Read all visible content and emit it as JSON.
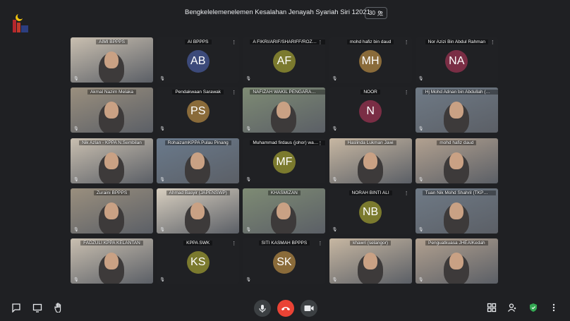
{
  "meeting": {
    "title": "Bengkelelemenelemen Kesalahan Jenayah Syariah Siri 12021",
    "participant_count": "30"
  },
  "colors": {
    "background": "#1f2023",
    "tile": "#3c4043",
    "hangup": "#ea4335",
    "shield": "#34a853"
  },
  "tiles": [
    {
      "name": "AIMI BPPPS",
      "initials": "",
      "avatar_color": "",
      "type": "video"
    },
    {
      "name": "AI BPPPS",
      "initials": "AB",
      "avatar_color": "#3c4a7a",
      "type": "avatar"
    },
    {
      "name": "A FIKRI/ARIF/SHARIFF/ROZAINA ...",
      "initials": "AF",
      "avatar_color": "#7b7a2e",
      "type": "avatar"
    },
    {
      "name": "mohd hafiz bin daud",
      "initials": "MH",
      "avatar_color": "#8a6b3a",
      "type": "avatar"
    },
    {
      "name": "Nor Azizi Bin Abdul Rahman",
      "initials": "NA",
      "avatar_color": "#7a2e45",
      "type": "avatar"
    },
    {
      "name": "Akmal Nazim Melaka",
      "initials": "",
      "avatar_color": "",
      "type": "video"
    },
    {
      "name": "Pendakwaan Sarawak",
      "initials": "PS",
      "avatar_color": "#8a6b3a",
      "type": "avatar"
    },
    {
      "name": "NAFIZAH WAKIL PENGARAH BPP...",
      "initials": "",
      "avatar_color": "",
      "type": "video"
    },
    {
      "name": "NOOR",
      "initials": "N",
      "avatar_color": "#7a2e45",
      "type": "avatar"
    },
    {
      "name": "Hj Mohd Adnan bin Abdullah (JHEA...",
      "initials": "",
      "avatar_color": "",
      "type": "video"
    },
    {
      "name": "Nik Azlan - KPPA N.Sembilan",
      "initials": "",
      "avatar_color": "",
      "type": "video"
    },
    {
      "name": "RohaizamKPPA Pulau Pinang",
      "initials": "",
      "avatar_color": "",
      "type": "video"
    },
    {
      "name": "Muhammad firdaus (johor) wakil kppa",
      "initials": "MF",
      "avatar_color": "#7b7a2e",
      "type": "avatar"
    },
    {
      "name": "Haslinda Lukman Jawi",
      "initials": "",
      "avatar_color": "",
      "type": "video"
    },
    {
      "name": "mohd hafiz daud",
      "initials": "",
      "avatar_color": "",
      "type": "video"
    },
    {
      "name": "Zuraini BPPPS",
      "initials": "",
      "avatar_color": "",
      "type": "video"
    },
    {
      "name": "Ahmad Basyir (JAPENSWP)",
      "initials": "",
      "avatar_color": "",
      "type": "video"
    },
    {
      "name": "KHASMIZAN",
      "initials": "",
      "avatar_color": "",
      "type": "video"
    },
    {
      "name": "NORAH BINTI ALI",
      "initials": "NB",
      "avatar_color": "#7b7a2e",
      "type": "avatar"
    },
    {
      "name": "Tuan Nik Mohd Shahril (TKPS JP",
      "initials": "",
      "avatar_color": "",
      "type": "video"
    },
    {
      "name": "FADZULI KPPA KELANTAN",
      "initials": "",
      "avatar_color": "",
      "type": "video"
    },
    {
      "name": "KPPA SWK",
      "initials": "KS",
      "avatar_color": "#7b7a2e",
      "type": "avatar"
    },
    {
      "name": "SITI KASMAH BPPPS",
      "initials": "SK",
      "avatar_color": "#8a6b3a",
      "type": "avatar"
    },
    {
      "name": "khawri (selangor)",
      "initials": "",
      "avatar_color": "",
      "type": "video"
    },
    {
      "name": "Penguatkuasa JHEAIKedah",
      "initials": "",
      "avatar_color": "",
      "type": "video"
    }
  ],
  "icons": {
    "chat": "chat-icon",
    "present": "present-screen-icon",
    "raise_hand": "raise-hand-icon",
    "mic": "mic-icon",
    "hangup": "hangup-icon",
    "camera": "camera-icon",
    "layout": "layout-grid-icon",
    "participants": "participants-icon",
    "shield": "shield-icon",
    "more": "more-vert-icon"
  }
}
